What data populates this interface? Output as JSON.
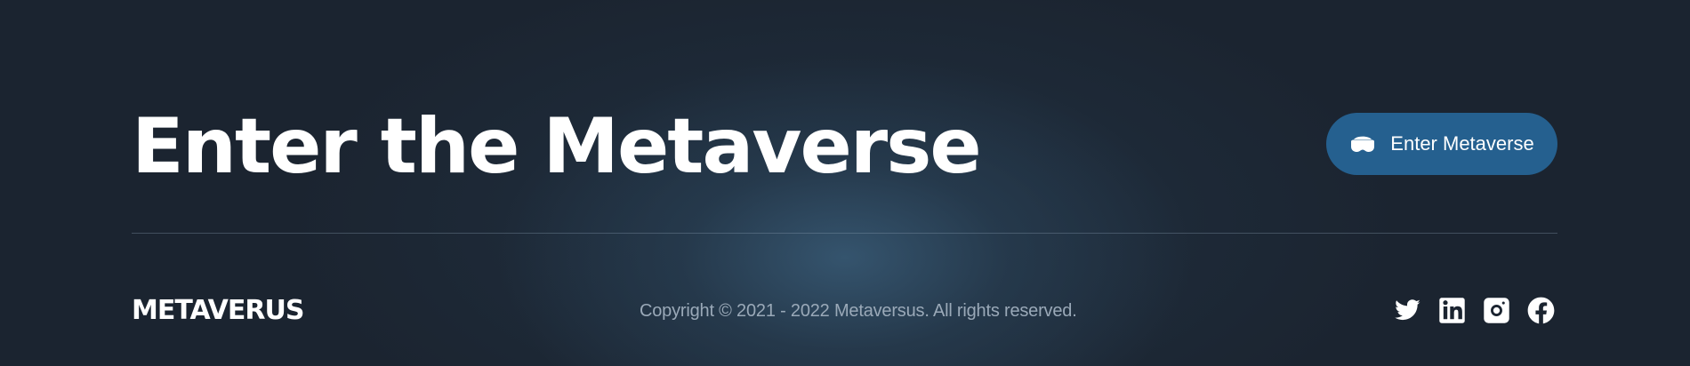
{
  "hero": {
    "title": "Enter the Metaverse"
  },
  "cta": {
    "label": "Enter Metaverse",
    "icon": "vr-headset-icon",
    "background": "#25608f"
  },
  "footer": {
    "brand": "METAVERUS",
    "copyright": "Copyright © 2021 - 2022 Metaversus. All rights reserved.",
    "socials": [
      {
        "name": "twitter",
        "icon": "twitter-icon"
      },
      {
        "name": "linkedin",
        "icon": "linkedin-icon"
      },
      {
        "name": "instagram",
        "icon": "instagram-icon"
      },
      {
        "name": "facebook",
        "icon": "facebook-icon"
      }
    ]
  },
  "colors": {
    "background": "#1b2430",
    "glow": "#365670",
    "text": "#ffffff",
    "muted_text": "#9aa9b8"
  }
}
